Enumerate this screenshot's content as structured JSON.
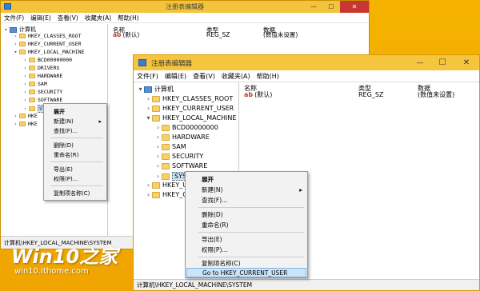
{
  "window_title": "注册表编辑器",
  "menu": [
    "文件(F)",
    "编辑(E)",
    "查看(V)",
    "收藏夹(A)",
    "帮助(H)"
  ],
  "controls": {
    "minimize": "—",
    "maximize": "☐",
    "close": "✕"
  },
  "tree": {
    "root": "计算机",
    "keys": [
      "HKEY_CLASSES_ROOT",
      "HKEY_CURRENT_USER",
      "HKEY_LOCAL_MACHINE"
    ],
    "subkeys": [
      "BCD00000000",
      "HARDWARE",
      "SAM",
      "SECURITY",
      "SOFTWARE",
      "SYSTEM"
    ],
    "hklm_key": "HKEY_LOCAL_MACHINE",
    "system_key": "SYSTEM",
    "back_truncated_1": "HKE",
    "back_truncated_2": "HKE",
    "front_truncated_1": "HKEY_U",
    "front_truncated_2": "HKEY_C"
  },
  "list": {
    "col_name": "名称",
    "col_type": "类型",
    "col_data": "数据",
    "row_name": "(默认)",
    "row_type": "REG_SZ",
    "row_data": "(数值未设置)"
  },
  "status_path": "计算机\\HKEY_LOCAL_MACHINE\\SYSTEM",
  "context_menu_back": {
    "items": [
      "展开",
      "新建(N)",
      "查找(F)...",
      "删除(D)",
      "重命名(R)",
      "导出(E)",
      "权限(P)...",
      "复制项名称(C)"
    ],
    "submenu_arrow": "▸"
  },
  "context_menu_front": {
    "items": [
      "展开",
      "新建(N)",
      "查找(F)...",
      "删除(D)",
      "重命名(R)",
      "导出(E)",
      "权限(P)...",
      "复制项名称(C)",
      "Go to HKEY_CURRENT_USER"
    ],
    "submenu_arrow": "▸"
  },
  "watermark": {
    "brand": "Win10之家",
    "url": "win10.ithome.com"
  },
  "colors": {
    "desktop": "#f3b000",
    "close": "#c7372f",
    "accent": "#1f6fc5",
    "highlight": "#cde4f7"
  }
}
